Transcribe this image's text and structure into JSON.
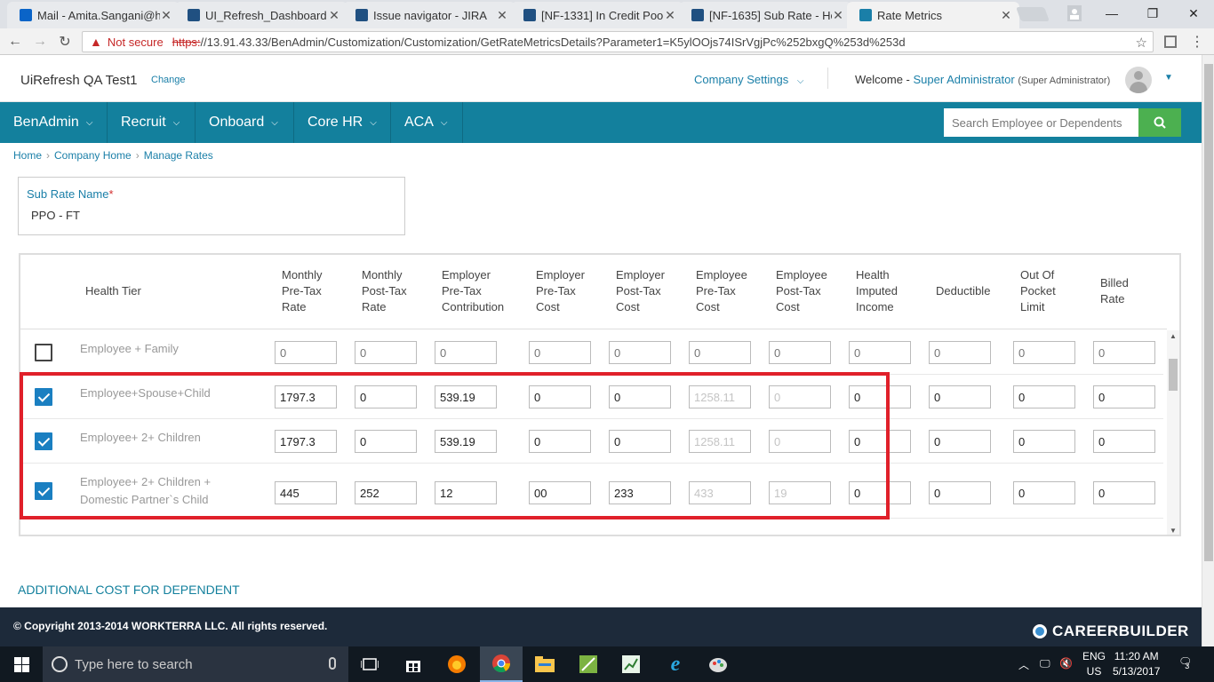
{
  "browser": {
    "tabs": [
      {
        "title": "Mail - Amita.Sangani@h",
        "icon": "outlook-icon",
        "color": "#0a64c8"
      },
      {
        "title": "UI_Refresh_Dashboard -",
        "icon": "jira-icon",
        "color": "#205081"
      },
      {
        "title": "Issue navigator - JIRA",
        "icon": "jira-icon",
        "color": "#205081"
      },
      {
        "title": "[NF-1331] In Credit Poo",
        "icon": "jira-icon",
        "color": "#205081"
      },
      {
        "title": "[NF-1635] Sub Rate - He",
        "icon": "jira-icon",
        "color": "#205081"
      },
      {
        "title": "Rate Metrics",
        "icon": "app-icon",
        "color": "#1a7fa8"
      }
    ],
    "not_secure": "Not secure",
    "url_https": "https:",
    "url_rest": "//13.91.43.33/BenAdmin/Customization/Customization/GetRateMetricsDetails?Parameter1=K5ylOOjs74ISrVgjPc%252bxgQ%253d%253d"
  },
  "header": {
    "company": "UiRefresh QA Test1",
    "change": "Change",
    "settings": "Company Settings",
    "welcome": "Welcome -",
    "user": "Super Administrator",
    "role": "(Super Administrator)"
  },
  "nav": {
    "items": [
      "BenAdmin",
      "Recruit",
      "Onboard",
      "Core HR",
      "ACA"
    ],
    "search_placeholder": "Search Employee or Dependents"
  },
  "breadcrumb": [
    "Home",
    "Company Home",
    "Manage Rates"
  ],
  "subrate": {
    "label": "Sub Rate Name",
    "required": "*",
    "value": "PPO - FT"
  },
  "grid": {
    "tier_header": "Health Tier",
    "columns": [
      [
        "Monthly",
        "Pre-Tax",
        "Rate"
      ],
      [
        "Monthly",
        "Post-Tax",
        "Rate"
      ],
      [
        "Employer",
        "Pre-Tax",
        "Contribution"
      ],
      [
        "Employer",
        "Pre-Tax",
        "Cost"
      ],
      [
        "Employer",
        "Post-Tax",
        "Cost"
      ],
      [
        "Employee",
        "Pre-Tax",
        "Cost"
      ],
      [
        "Employee",
        "Post-Tax",
        "Cost"
      ],
      [
        "Health",
        "Imputed",
        "Income"
      ],
      [
        "Deductible"
      ],
      [
        "Out Of",
        "Pocket",
        "Limit"
      ],
      [
        "Billed",
        "Rate"
      ]
    ],
    "rows": [
      {
        "tier": [
          "Employee + Family"
        ],
        "checked": false,
        "values": [
          "0",
          "0",
          "0",
          "0",
          "0",
          "0",
          "0",
          "0",
          "0",
          "0",
          "0"
        ],
        "placeholder": true
      },
      {
        "tier": [
          "Employee+Spouse+Child"
        ],
        "checked": true,
        "values": [
          "1797.3",
          "0",
          "539.19",
          "0",
          "0",
          "1258.11",
          "0",
          "0",
          "0",
          "0",
          "0"
        ]
      },
      {
        "tier": [
          "Employee+ 2+ Children"
        ],
        "checked": true,
        "values": [
          "1797.3",
          "0",
          "539.19",
          "0",
          "0",
          "1258.11",
          "0",
          "0",
          "0",
          "0",
          "0"
        ]
      },
      {
        "tier": [
          "Employee+ 2+ Children +",
          "Domestic Partner`s Child"
        ],
        "checked": true,
        "values": [
          "445",
          "252",
          "12",
          "00",
          "233",
          "433",
          "19",
          "0",
          "0",
          "0",
          "0"
        ]
      },
      {
        "tier": [
          "Employee+ 2+ Children"
        ],
        "checked": false,
        "values": [],
        "partial": true
      }
    ]
  },
  "additional": "ADDITIONAL COST FOR DEPENDENT",
  "footer": {
    "copyright": "© Copyright 2013-2014 WORKTERRA LLC. All rights reserved.",
    "logo": "CAREERBUILDER"
  },
  "taskbar": {
    "search": "Type here to search",
    "lang1": "ENG",
    "lang2": "US",
    "time": "11:20 AM",
    "date": "5/13/2017",
    "notif": "3"
  }
}
